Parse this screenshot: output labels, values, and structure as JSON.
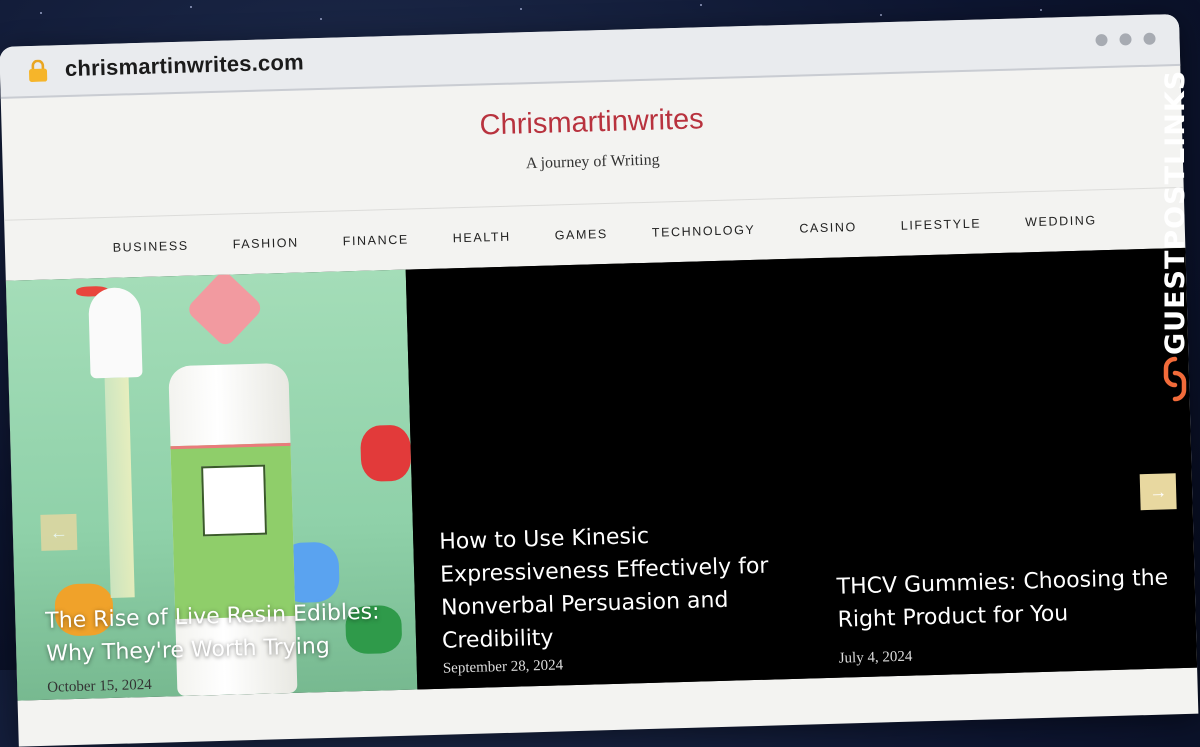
{
  "browser": {
    "url": "chrismartinwrites.com"
  },
  "site": {
    "title": "Chrismartinwrites",
    "tagline": "A journey of Writing"
  },
  "nav": {
    "items": [
      "BUSINESS",
      "FASHION",
      "FINANCE",
      "HEALTH",
      "GAMES",
      "TECHNOLOGY",
      "CASINO",
      "LIFESTYLE",
      "WEDDING"
    ]
  },
  "slider": {
    "prev_label": "←",
    "next_label": "→",
    "slides": [
      {
        "title": "The Rise of Live Resin Edibles: Why They're Worth Trying",
        "date": "October 15, 2024"
      },
      {
        "title": "How to Use Kinesic Expressiveness Effectively for Nonverbal Persuasion and Credibility",
        "date": "September 28, 2024"
      },
      {
        "title": "THCV Gummies: Choosing the Right Product for You",
        "date": "July 4, 2024"
      }
    ]
  },
  "watermark": {
    "text": "GUESTPOSTLINKS"
  },
  "colors": {
    "brand": "#b8323e",
    "arrow": "#e8d8a0",
    "watermark_icon": "#f26b3a"
  }
}
